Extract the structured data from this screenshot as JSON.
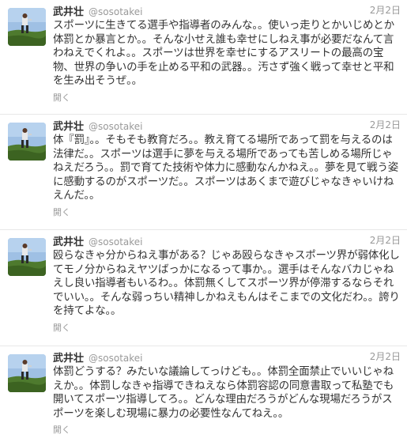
{
  "tweets": [
    {
      "fullname": "武井壮",
      "username": "@sosotakei",
      "time": "2月2日",
      "text": "スポーツに生きてる選手や指導者のみんな。。使いっ走りとかいじめとか体罰とか暴言とか。。そんな小せえ誰も幸せにしねえ事が必要だなんて言わねえでくれよ。。スポーツは世界を幸せにするアスリートの最高の宝物、世界の争いの手を止める平和の武器。。汚さず強く戦って幸せと平和を生み出そうぜ。。",
      "expand": "開く"
    },
    {
      "fullname": "武井壮",
      "username": "@sosotakei",
      "time": "2月2日",
      "text": "体『罰』。。そもそも教育だろ。。教え育てる場所であって罰を与えるのは法律だ。。スポーツは選手に夢を与える場所であっても苦しめる場所じゃねえだろう。。罰で育てた技術や体力に感動なんかねえ。。夢を見て戦う姿に感動するのがスポーツだ。。スポーツはあくまで遊びじゃなきゃいけねえんだ。。",
      "expand": "開く"
    },
    {
      "fullname": "武井壮",
      "username": "@sosotakei",
      "time": "2月2日",
      "text": "殴らなきゃ分からねえ事がある？じゃあ殴らなきゃスポーツ界が弱体化してモノ分からねえヤツばっかになるって事か。。選手はそんなバカじゃねえし良い指導者もいるわ。。体罰無くしてスポーツ界が停滞するならそれでいい。。そんな弱っちい精神しかねえもんはそこまでの文化だわ。。誇りを持てよな。。",
      "expand": "開く"
    },
    {
      "fullname": "武井壮",
      "username": "@sosotakei",
      "time": "2月2日",
      "text": "体罰どうする？みたいな議論してっけども。。体罰全面禁止でいいじゃねえか。。体罰しなきゃ指導できねえなら体罰容認の同意書取って私塾でも開いてスポーツ指導してろ。。どんな理由だろうがどんな現場だろうがスポーツを楽しむ現場に暴力の必要性なんてねえ。。",
      "expand": "開く"
    }
  ],
  "colors": {
    "name": "#333333",
    "meta": "#999999",
    "divider": "#e8e8e8"
  }
}
